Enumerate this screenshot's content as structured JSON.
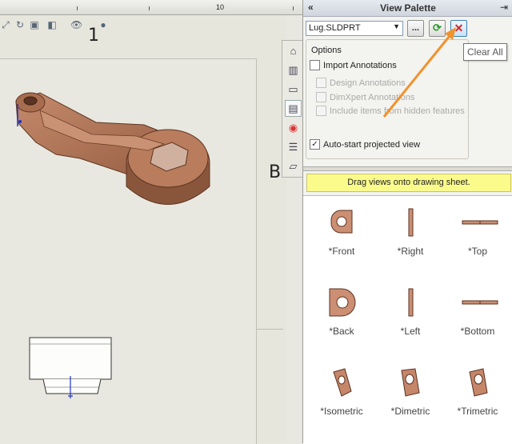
{
  "ruler": {
    "number": "10"
  },
  "drawing": {
    "zone_top": "1",
    "zone_side": "B"
  },
  "palette": {
    "title": "View Palette",
    "collapse_glyph": "«",
    "pin_glyph": "⇥",
    "file_select": {
      "value": "Lug.SLDPRT"
    },
    "browse_label": "...",
    "tooltip": "Clear All",
    "options": {
      "label": "Options",
      "items": [
        {
          "label": "Import Annotations",
          "checked": false,
          "enabled": true
        },
        {
          "label": "Design Annotations",
          "checked": false,
          "enabled": false
        },
        {
          "label": "DimXpert Annotations",
          "checked": false,
          "enabled": false
        },
        {
          "label": "Include items from hidden features",
          "checked": false,
          "enabled": false
        },
        {
          "label": "Auto-start projected view",
          "checked": true,
          "enabled": true
        }
      ]
    },
    "banner": "Drag views onto drawing sheet.",
    "views": [
      "*Front",
      "*Right",
      "*Top",
      "*Back",
      "*Left",
      "*Bottom",
      "*Isometric",
      "*Dimetric",
      "*Trimetric"
    ]
  },
  "colors": {
    "part_copper": "#b27456",
    "part_dark": "#7a4a33",
    "banner_yellow": "#fbfb8c",
    "annotation_arrow": "#f0922e"
  },
  "icons": [
    "home-icon",
    "part-icon",
    "folder-icon",
    "view-palette-icon",
    "appearances-icon",
    "properties-icon",
    "forum-icon"
  ]
}
